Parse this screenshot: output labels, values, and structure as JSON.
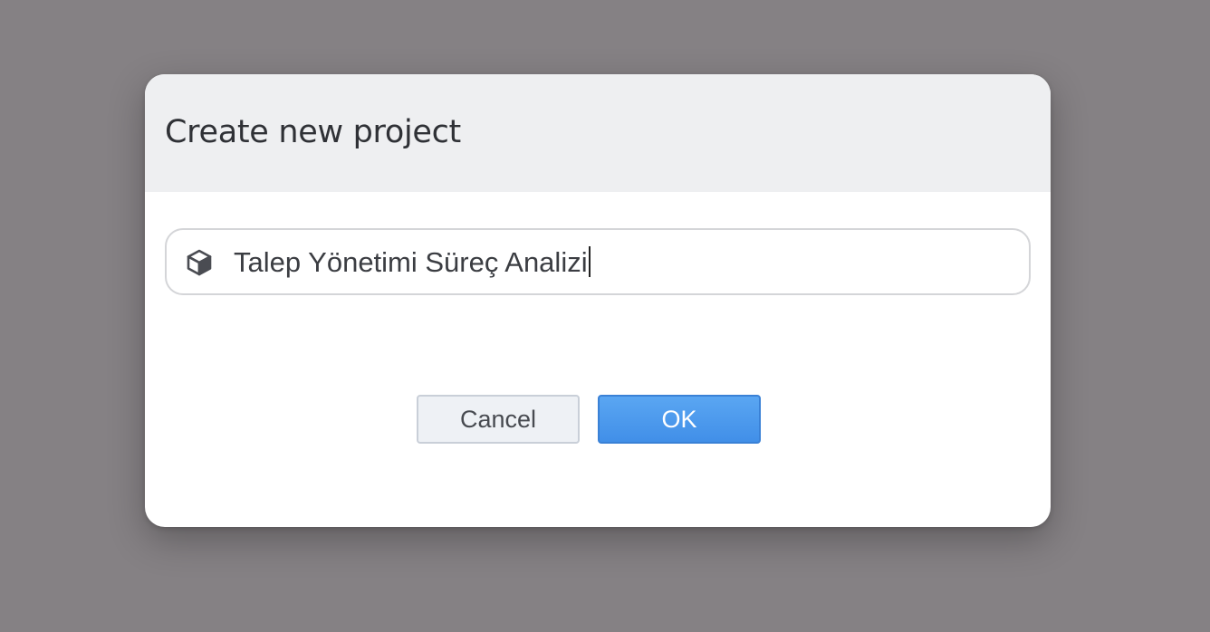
{
  "dialog": {
    "title": "Create new project",
    "project_name": {
      "value": "Talep Yönetimi Süreç Analizi",
      "icon": "cube-icon"
    },
    "buttons": {
      "cancel_label": "Cancel",
      "ok_label": "OK"
    }
  },
  "colors": {
    "backdrop": "#858184",
    "header": "#eeeff1",
    "ok_button": "#4a98ee",
    "cancel_button": "#eef1f5"
  }
}
